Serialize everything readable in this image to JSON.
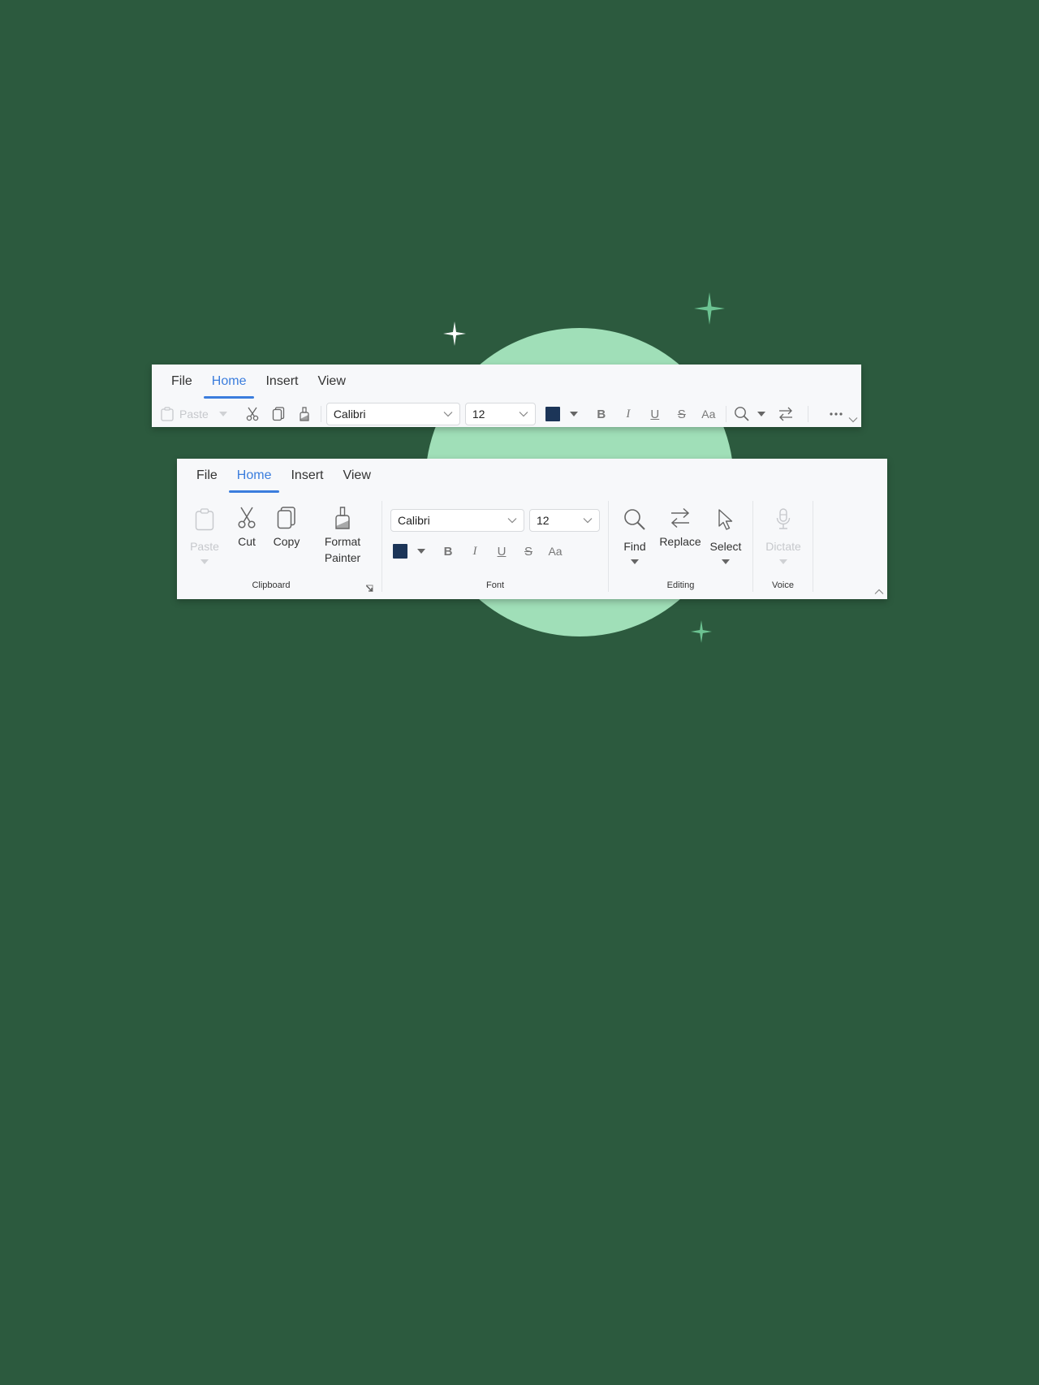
{
  "colors": {
    "background": "#2c5a3e",
    "circle": "#a0dfb8",
    "accent": "#3b7ddd",
    "font_color_swatch": "#1c3558",
    "sparkle_white": "#ffffff",
    "sparkle_green": "#6cc392"
  },
  "compact_ribbon": {
    "tabs": [
      {
        "label": "File",
        "active": false
      },
      {
        "label": "Home",
        "active": true
      },
      {
        "label": "Insert",
        "active": false
      },
      {
        "label": "View",
        "active": false
      }
    ],
    "toolbar": {
      "paste_label": "Paste",
      "paste_disabled": true,
      "font_name": "Calibri",
      "font_size": "12",
      "bold": "B",
      "italic": "I",
      "underline": "U",
      "strikethrough": "S",
      "change_case": "Aa",
      "more_icon": "ellipsis-icon",
      "expand_icon": "chevron-down-icon"
    }
  },
  "full_ribbon": {
    "tabs": [
      {
        "label": "File",
        "active": false
      },
      {
        "label": "Home",
        "active": true
      },
      {
        "label": "Insert",
        "active": false
      },
      {
        "label": "View",
        "active": false
      }
    ],
    "groups": {
      "clipboard": {
        "label": "Clipboard",
        "paste": "Paste",
        "cut": "Cut",
        "copy": "Copy",
        "format_painter_line1": "Format",
        "format_painter_line2": "Painter"
      },
      "font": {
        "label": "Font",
        "font_name": "Calibri",
        "font_size": "12",
        "bold": "B",
        "italic": "I",
        "underline": "U",
        "strikethrough": "S",
        "change_case": "Aa"
      },
      "editing": {
        "label": "Editing",
        "find": "Find",
        "replace": "Replace",
        "select": "Select"
      },
      "voice": {
        "label": "Voice",
        "dictate": "Dictate",
        "dictate_disabled": true
      }
    },
    "collapse_icon": "chevron-up-icon"
  }
}
